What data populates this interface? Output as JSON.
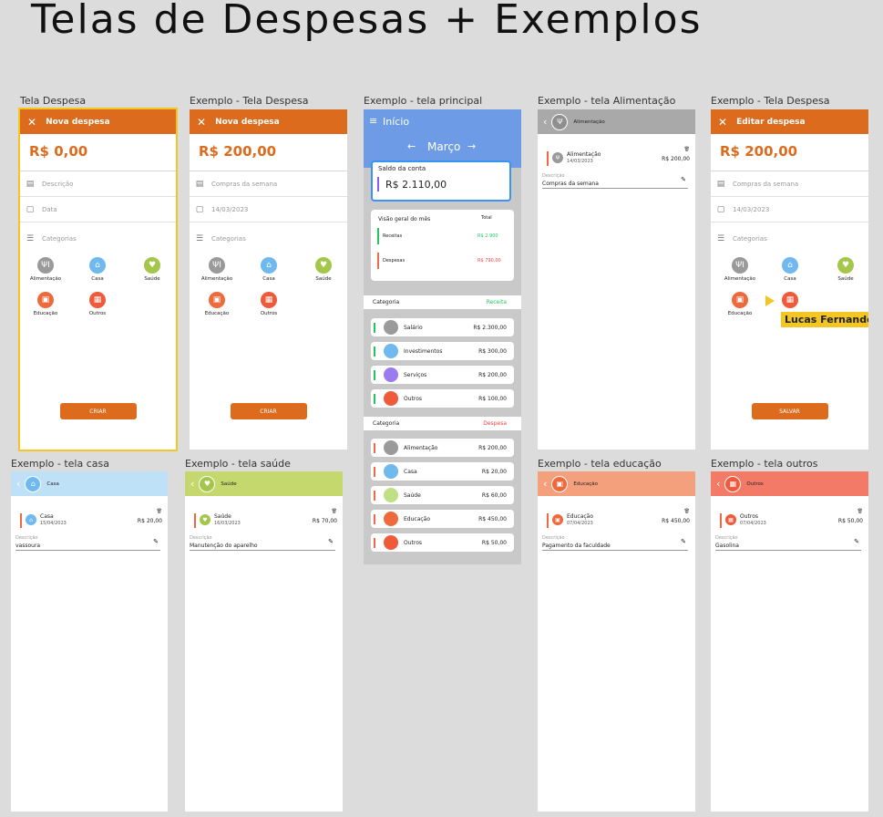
{
  "page_title": "Telas de Despesas + Exemplos",
  "frame_labels": {
    "f1": "Tela Despesa",
    "f2": "Exemplo - Tela Despesa",
    "f3": "Exemplo - tela principal",
    "f4": "Exemplo - tela Alimentação",
    "f5": "Exemplo - Tela Despesa",
    "f6": "Exemplo - tela casa",
    "f7": "Exemplo - tela saúde",
    "f8": "Exemplo - tela educação",
    "f9": "Exemplo - tela outros"
  },
  "form": {
    "new_title": "Nova despesa",
    "edit_title": "Editar despesa",
    "empty_amount": "R$ 0,00",
    "amount": "R$ 200,00",
    "desc_placeholder": "Descrição",
    "date_placeholder": "Data",
    "desc_value": "Compras da semana",
    "date_value": "14/03/2023",
    "categories_label": "Categorias",
    "create_label": "CRIAR",
    "save_label": "SALVAR"
  },
  "categories": {
    "alimentacao": "Alimentação",
    "casa": "Casa",
    "saude": "Saúde",
    "educacao": "Educação",
    "outros": "Outros"
  },
  "cursor_label": "Lucas Fernando",
  "main": {
    "menu_title": "Início",
    "month": "Março",
    "balance_label": "Saldo da conta",
    "balance": "R$ 2.110,00",
    "overview_label": "Visão geral do mês",
    "total_label": "Total",
    "income_label": "Receitas",
    "income_value": "R$ 2.900",
    "expense_label": "Despesas",
    "expense_value": "R$ 790,00",
    "category_label": "Categoria",
    "income_tag": "Receita",
    "expense_tag": "Despesa",
    "income_items": [
      {
        "name": "Salário",
        "value": "R$ 2.300,00"
      },
      {
        "name": "Investimentos",
        "value": "R$ 300,00"
      },
      {
        "name": "Serviços",
        "value": "R$ 200,00"
      },
      {
        "name": "Outros",
        "value": "R$ 100,00"
      }
    ],
    "expense_items": [
      {
        "name": "Alimentação",
        "value": "R$ 200,00"
      },
      {
        "name": "Casa",
        "value": "R$ 20,00"
      },
      {
        "name": "Saúde",
        "value": "R$ 60,00"
      },
      {
        "name": "Educação",
        "value": "R$ 450,00"
      },
      {
        "name": "Outros",
        "value": "R$ 50,00"
      }
    ]
  },
  "details": {
    "desc_label": "Descrição",
    "alimentacao": {
      "title": "Alimentação",
      "date": "14/03/2023",
      "value": "R$ 200,00",
      "desc": "Compras da semana"
    },
    "casa": {
      "title": "Casa",
      "date": "15/04/2023",
      "value": "R$ 20,00",
      "desc": "vassoura"
    },
    "saude": {
      "title": "Saúde",
      "date": "16/03/2023",
      "value": "R$ 70,00",
      "desc": "Manutenção do aparelho"
    },
    "educacao": {
      "title": "Educação",
      "date": "07/04/2023",
      "value": "R$ 450,00",
      "desc": "Pagamento da faculdade"
    },
    "outros": {
      "title": "Outros",
      "date": "07/04/2023",
      "value": "R$ 50,00",
      "desc": "Gasolina"
    }
  },
  "colors": {
    "orange": "#dd6b1d",
    "blue": "#6e9be6",
    "alimentacao": "#9a9a9a",
    "casa": "#6fb9ee",
    "saude": "#a4c64a",
    "educacao": "#ee6a3d",
    "outros": "#ee5a3a"
  }
}
